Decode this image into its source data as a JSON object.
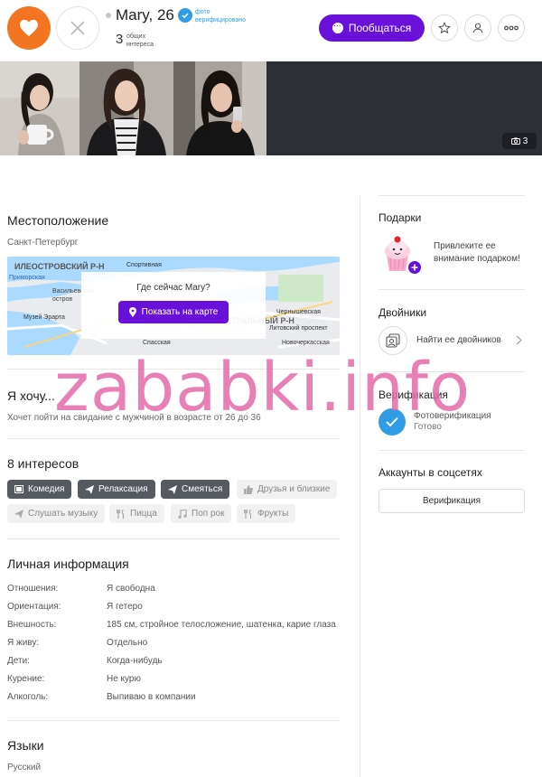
{
  "profile": {
    "name": "Mary, 26",
    "verified_label": "фото верифицировано",
    "common_count": "3",
    "common_label": "общих интереса"
  },
  "actions": {
    "chat_label": "Пообщаться"
  },
  "photos": {
    "count": "3"
  },
  "location": {
    "title": "Местоположение",
    "city": "Санкт-Петербург",
    "map_question": "Где сейчас Mary?",
    "map_button": "Показать на карте",
    "map_labels": [
      "ИЛЕОСТРОВСКИЙ Р-Н",
      "Спортивная",
      "Приморская",
      "Васильевский остров",
      "Музей Эрарта",
      "ТРАЛЬНЫЙ Р-Н",
      "Чернышевская",
      "Новочеркасская",
      "Спасская",
      "Литовский проспект"
    ]
  },
  "wants": {
    "title": "Я хочу...",
    "text": "Хочет пойти на свидание с мужчиной в возрасте от 26 до 36"
  },
  "interests": {
    "title": "8 интересов",
    "items": [
      {
        "label": "Комедия",
        "common": true,
        "icon": "film-icon"
      },
      {
        "label": "Релаксация",
        "common": true,
        "icon": "paper-plane-icon"
      },
      {
        "label": "Смеяться",
        "common": true,
        "icon": "paper-plane-icon"
      },
      {
        "label": "Друзья и близкие",
        "common": false,
        "icon": "thumbs-up-icon"
      },
      {
        "label": "Слушать музыку",
        "common": false,
        "icon": "paper-plane-icon"
      },
      {
        "label": "Пицца",
        "common": false,
        "icon": "fork-knife-icon"
      },
      {
        "label": "Поп рок",
        "common": false,
        "icon": "music-note-icon"
      },
      {
        "label": "Фрукты",
        "common": false,
        "icon": "fork-knife-icon"
      }
    ]
  },
  "personal": {
    "title": "Личная информация",
    "rows": [
      {
        "label": "Отношения:",
        "value": "Я свободна"
      },
      {
        "label": "Ориентация:",
        "value": "Я гетеро"
      },
      {
        "label": "Внешность:",
        "value": "185 см, стройное телосложение, шатенка, карие глаза"
      },
      {
        "label": "Я живу:",
        "value": "Отдельно"
      },
      {
        "label": "Дети:",
        "value": "Когда-нибудь"
      },
      {
        "label": "Курение:",
        "value": "Не курю"
      },
      {
        "label": "Алкоголь:",
        "value": "Выпиваю в компании"
      }
    ]
  },
  "languages": {
    "title": "Языки",
    "value": "Русский"
  },
  "sidebar": {
    "gifts_title": "Подарки",
    "gifts_text": "Привлеките ее внимание подарком!",
    "twins_title": "Двойники",
    "twins_text": "Найти ее двойников",
    "verification_title": "Верификация",
    "photo_verif": "Фотоверификация",
    "photo_verif_status": "Готово",
    "social_title": "Аккаунты в соцсетях",
    "social_button": "Верификация"
  },
  "watermark": "zababki.info",
  "colors": {
    "accent": "#6a11d9",
    "like": "#f47521",
    "verified": "#2f9ce6"
  }
}
